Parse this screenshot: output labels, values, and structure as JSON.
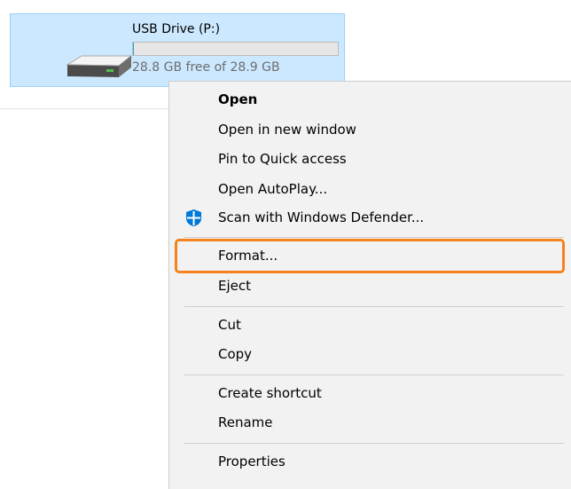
{
  "drive": {
    "name": "USB Drive (P:)",
    "free_text": "28.8 GB free of 28.9 GB",
    "used_fraction": 0.0035,
    "icon": "usb-drive-icon"
  },
  "context_menu": {
    "items": [
      {
        "label": "Open",
        "bold": true
      },
      {
        "label": "Open in new window"
      },
      {
        "label": "Pin to Quick access"
      },
      {
        "label": "Open AutoPlay..."
      },
      {
        "label": "Scan with Windows Defender...",
        "icon": "windows-defender-icon"
      },
      {
        "label": "Format...",
        "highlighted": true
      },
      {
        "label": "Eject"
      },
      {
        "label": "Cut"
      },
      {
        "label": "Copy"
      },
      {
        "label": "Create shortcut"
      },
      {
        "label": "Rename"
      },
      {
        "label": "Properties"
      }
    ]
  },
  "colors": {
    "selection_background": "#cce8ff",
    "selection_border": "#99d1ff",
    "highlight_outline": "#f5821f",
    "menu_background": "#f2f2f2",
    "defender_blue": "#0078d7"
  }
}
